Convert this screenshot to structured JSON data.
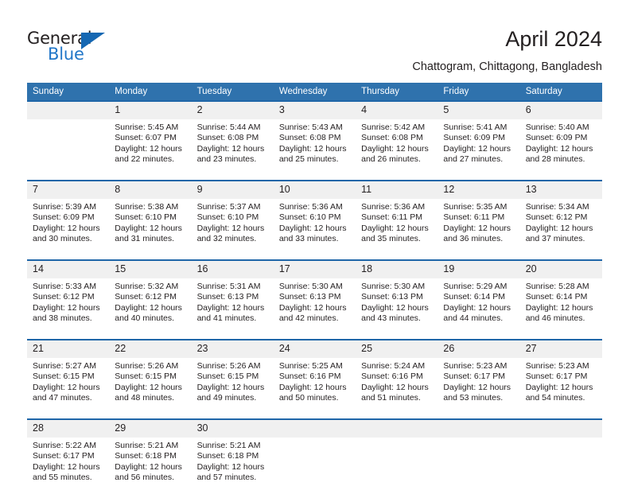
{
  "brand": {
    "name_top": "General",
    "name_bottom": "Blue",
    "accent_color": "#1567b2"
  },
  "header": {
    "title": "April 2024",
    "subtitle": "Chattogram, Chittagong, Bangladesh",
    "header_bg_color": "#2f72ad",
    "separator_color": "#1f66a8",
    "daynum_band_color": "#f0f0f0"
  },
  "weekdays": [
    "Sunday",
    "Monday",
    "Tuesday",
    "Wednesday",
    "Thursday",
    "Friday",
    "Saturday"
  ],
  "weeks": [
    [
      {
        "day": "",
        "lines": []
      },
      {
        "day": "1",
        "lines": [
          "Sunrise: 5:45 AM",
          "Sunset: 6:07 PM",
          "Daylight: 12 hours",
          "and 22 minutes."
        ]
      },
      {
        "day": "2",
        "lines": [
          "Sunrise: 5:44 AM",
          "Sunset: 6:08 PM",
          "Daylight: 12 hours",
          "and 23 minutes."
        ]
      },
      {
        "day": "3",
        "lines": [
          "Sunrise: 5:43 AM",
          "Sunset: 6:08 PM",
          "Daylight: 12 hours",
          "and 25 minutes."
        ]
      },
      {
        "day": "4",
        "lines": [
          "Sunrise: 5:42 AM",
          "Sunset: 6:08 PM",
          "Daylight: 12 hours",
          "and 26 minutes."
        ]
      },
      {
        "day": "5",
        "lines": [
          "Sunrise: 5:41 AM",
          "Sunset: 6:09 PM",
          "Daylight: 12 hours",
          "and 27 minutes."
        ]
      },
      {
        "day": "6",
        "lines": [
          "Sunrise: 5:40 AM",
          "Sunset: 6:09 PM",
          "Daylight: 12 hours",
          "and 28 minutes."
        ]
      }
    ],
    [
      {
        "day": "7",
        "lines": [
          "Sunrise: 5:39 AM",
          "Sunset: 6:09 PM",
          "Daylight: 12 hours",
          "and 30 minutes."
        ]
      },
      {
        "day": "8",
        "lines": [
          "Sunrise: 5:38 AM",
          "Sunset: 6:10 PM",
          "Daylight: 12 hours",
          "and 31 minutes."
        ]
      },
      {
        "day": "9",
        "lines": [
          "Sunrise: 5:37 AM",
          "Sunset: 6:10 PM",
          "Daylight: 12 hours",
          "and 32 minutes."
        ]
      },
      {
        "day": "10",
        "lines": [
          "Sunrise: 5:36 AM",
          "Sunset: 6:10 PM",
          "Daylight: 12 hours",
          "and 33 minutes."
        ]
      },
      {
        "day": "11",
        "lines": [
          "Sunrise: 5:36 AM",
          "Sunset: 6:11 PM",
          "Daylight: 12 hours",
          "and 35 minutes."
        ]
      },
      {
        "day": "12",
        "lines": [
          "Sunrise: 5:35 AM",
          "Sunset: 6:11 PM",
          "Daylight: 12 hours",
          "and 36 minutes."
        ]
      },
      {
        "day": "13",
        "lines": [
          "Sunrise: 5:34 AM",
          "Sunset: 6:12 PM",
          "Daylight: 12 hours",
          "and 37 minutes."
        ]
      }
    ],
    [
      {
        "day": "14",
        "lines": [
          "Sunrise: 5:33 AM",
          "Sunset: 6:12 PM",
          "Daylight: 12 hours",
          "and 38 minutes."
        ]
      },
      {
        "day": "15",
        "lines": [
          "Sunrise: 5:32 AM",
          "Sunset: 6:12 PM",
          "Daylight: 12 hours",
          "and 40 minutes."
        ]
      },
      {
        "day": "16",
        "lines": [
          "Sunrise: 5:31 AM",
          "Sunset: 6:13 PM",
          "Daylight: 12 hours",
          "and 41 minutes."
        ]
      },
      {
        "day": "17",
        "lines": [
          "Sunrise: 5:30 AM",
          "Sunset: 6:13 PM",
          "Daylight: 12 hours",
          "and 42 minutes."
        ]
      },
      {
        "day": "18",
        "lines": [
          "Sunrise: 5:30 AM",
          "Sunset: 6:13 PM",
          "Daylight: 12 hours",
          "and 43 minutes."
        ]
      },
      {
        "day": "19",
        "lines": [
          "Sunrise: 5:29 AM",
          "Sunset: 6:14 PM",
          "Daylight: 12 hours",
          "and 44 minutes."
        ]
      },
      {
        "day": "20",
        "lines": [
          "Sunrise: 5:28 AM",
          "Sunset: 6:14 PM",
          "Daylight: 12 hours",
          "and 46 minutes."
        ]
      }
    ],
    [
      {
        "day": "21",
        "lines": [
          "Sunrise: 5:27 AM",
          "Sunset: 6:15 PM",
          "Daylight: 12 hours",
          "and 47 minutes."
        ]
      },
      {
        "day": "22",
        "lines": [
          "Sunrise: 5:26 AM",
          "Sunset: 6:15 PM",
          "Daylight: 12 hours",
          "and 48 minutes."
        ]
      },
      {
        "day": "23",
        "lines": [
          "Sunrise: 5:26 AM",
          "Sunset: 6:15 PM",
          "Daylight: 12 hours",
          "and 49 minutes."
        ]
      },
      {
        "day": "24",
        "lines": [
          "Sunrise: 5:25 AM",
          "Sunset: 6:16 PM",
          "Daylight: 12 hours",
          "and 50 minutes."
        ]
      },
      {
        "day": "25",
        "lines": [
          "Sunrise: 5:24 AM",
          "Sunset: 6:16 PM",
          "Daylight: 12 hours",
          "and 51 minutes."
        ]
      },
      {
        "day": "26",
        "lines": [
          "Sunrise: 5:23 AM",
          "Sunset: 6:17 PM",
          "Daylight: 12 hours",
          "and 53 minutes."
        ]
      },
      {
        "day": "27",
        "lines": [
          "Sunrise: 5:23 AM",
          "Sunset: 6:17 PM",
          "Daylight: 12 hours",
          "and 54 minutes."
        ]
      }
    ],
    [
      {
        "day": "28",
        "lines": [
          "Sunrise: 5:22 AM",
          "Sunset: 6:17 PM",
          "Daylight: 12 hours",
          "and 55 minutes."
        ]
      },
      {
        "day": "29",
        "lines": [
          "Sunrise: 5:21 AM",
          "Sunset: 6:18 PM",
          "Daylight: 12 hours",
          "and 56 minutes."
        ]
      },
      {
        "day": "30",
        "lines": [
          "Sunrise: 5:21 AM",
          "Sunset: 6:18 PM",
          "Daylight: 12 hours",
          "and 57 minutes."
        ]
      },
      {
        "day": "",
        "lines": []
      },
      {
        "day": "",
        "lines": []
      },
      {
        "day": "",
        "lines": []
      },
      {
        "day": "",
        "lines": []
      }
    ]
  ]
}
